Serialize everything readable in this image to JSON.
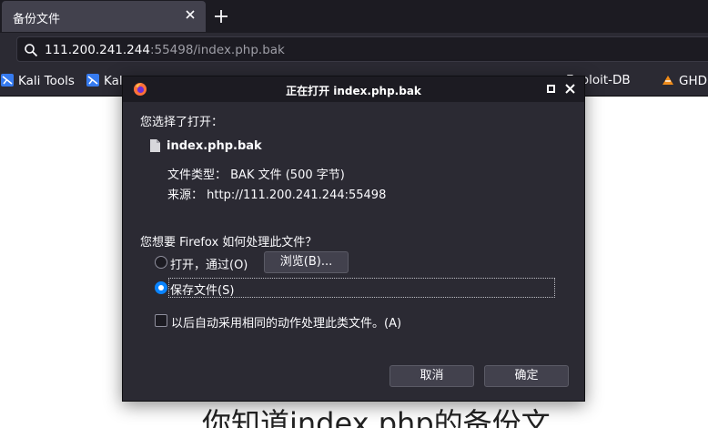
{
  "tab": {
    "title": "备份文件"
  },
  "urlbar": {
    "host": "111.200.241.244",
    "rest": ":55498/index.php.bak"
  },
  "bookmarks": [
    {
      "label": "Kali Tools"
    },
    {
      "label": "Kal"
    },
    {
      "label": "Exploit-DB"
    },
    {
      "label": "GHD"
    }
  ],
  "page": {
    "heading": "你知道index.php的备份文"
  },
  "dialog": {
    "title": "正在打开 index.php.bak",
    "chosen_label": "您选择了打开：",
    "filename": "index.php.bak",
    "file_type": "文件类型： BAK 文件 (500 字节)",
    "source": "来源： http://111.200.241.244:55498",
    "question": "您想要 Firefox 如何处理此文件？",
    "open_with_label": "打开，通过(O)",
    "browse_button": "浏览(B)...",
    "save_file_label": "保存文件(S)",
    "auto_label": "以后自动采用相同的动作处理此类文件。(A)",
    "cancel_button": "取消",
    "ok_button": "确定"
  },
  "colors": {
    "accent": "#0a84ff",
    "chrome_dark": "#1c1b22",
    "chrome": "#2b2a33"
  }
}
